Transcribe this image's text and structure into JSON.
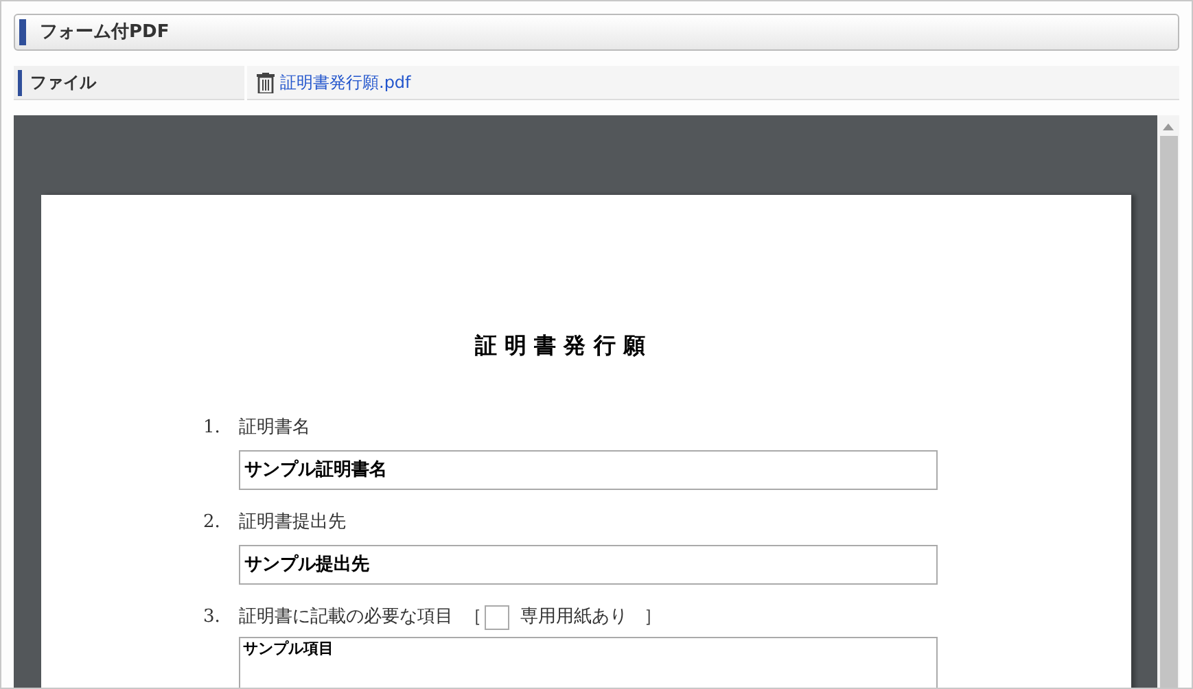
{
  "panel": {
    "title": "フォーム付PDF"
  },
  "file_row": {
    "label": "ファイル",
    "file_name": "証明書発行願.pdf"
  },
  "document": {
    "title": "証 明 書 発 行 願",
    "items": [
      {
        "kind": "field",
        "number": "1.",
        "label": "証明書名",
        "value": "サンプル証明書名"
      },
      {
        "kind": "field",
        "number": "2.",
        "label": "証明書提出先",
        "value": "サンプル提出先"
      },
      {
        "kind": "textarea",
        "number": "3.",
        "label": "証明書に記載の必要な項目",
        "bracket_open": "［",
        "checkbox_label": "専用用紙あり",
        "checked": false,
        "bracket_close": "］",
        "value": "サンプル項目"
      }
    ]
  }
}
